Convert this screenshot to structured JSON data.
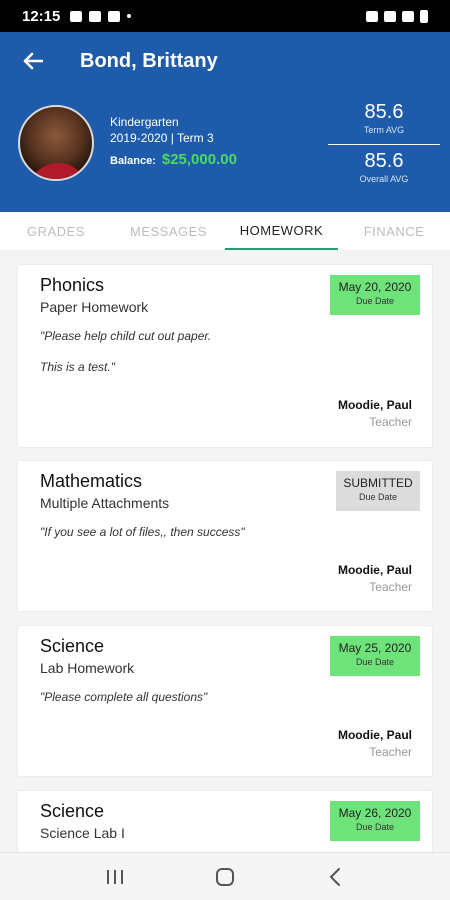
{
  "status_bar": {
    "time": "12:15",
    "left_icons": [
      "image-icon",
      "alert-icon",
      "mail-icon",
      "dot-icon"
    ],
    "right_icons": [
      "bluetooth-icon",
      "wifi-icon",
      "signal-icon",
      "battery-icon"
    ]
  },
  "header": {
    "back_icon": "arrow-left-icon",
    "title": "Bond, Brittany",
    "grade": "Kindergarten",
    "term": "2019-2020 | Term 3",
    "balance_label": "Balance:",
    "balance_value": "$25,000.00",
    "term_avg_value": "85.6",
    "term_avg_label": "Term AVG",
    "overall_avg_value": "85.6",
    "overall_avg_label": "Overall AVG"
  },
  "tabs": [
    {
      "label": "GRADES",
      "active": false
    },
    {
      "label": "MESSAGES",
      "active": false
    },
    {
      "label": "HOMEWORK",
      "active": true
    },
    {
      "label": "FINANCE",
      "active": false
    }
  ],
  "homework": [
    {
      "subject": "Phonics",
      "type": "Paper Homework",
      "notes": [
        "\"Please help child cut out paper.",
        "This is a test.\""
      ],
      "due_date": "May 20, 2020",
      "due_label": "Due Date",
      "teacher": "Moodie, Paul",
      "role": "Teacher"
    },
    {
      "subject": "Mathematics",
      "type": "Multiple Attachments",
      "notes": [
        "\"If you see a lot of files,, then success\""
      ],
      "due_date": "SUBMITTED",
      "due_label": "Due Date",
      "teacher": "Moodie, Paul",
      "role": "Teacher"
    },
    {
      "subject": "Science",
      "type": "Lab Homework",
      "notes": [
        "\"Please complete all questions\""
      ],
      "due_date": "May 25, 2020",
      "due_label": "Due Date",
      "teacher": "Moodie, Paul",
      "role": "Teacher"
    },
    {
      "subject": "Science",
      "type": "Science Lab I",
      "notes": [],
      "due_date": "May 26, 2020",
      "due_label": "Due Date",
      "teacher": "",
      "role": ""
    }
  ],
  "colors": {
    "header_bg": "#1e5cab",
    "balance": "#4cd964",
    "due_badge": "#6ee37a",
    "submitted_badge": "#dcdcdc",
    "tab_indicator": "#2a9a79"
  },
  "nav_bar": {
    "icons": [
      "recent-apps-icon",
      "home-icon",
      "back-icon"
    ]
  }
}
